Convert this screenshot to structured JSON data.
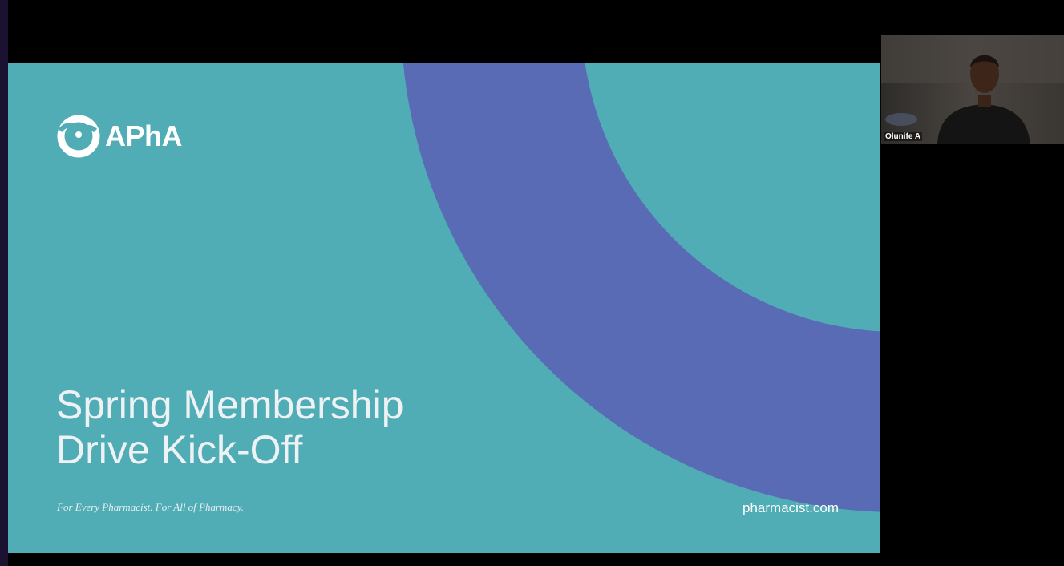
{
  "slide": {
    "logo_text": "APhA",
    "title_line1": "Spring Membership",
    "title_line2": "Drive Kick-Off",
    "tagline": "For Every Pharmacist. For All of Pharmacy.",
    "website": "pharmacist.com"
  },
  "participant": {
    "name": "Olunife A",
    "icon": "person-video-feed"
  },
  "colors": {
    "slide_background": "#50adb5",
    "arc": "#5a6bb5",
    "text": "#ffffff",
    "meeting_background": "#000000"
  }
}
